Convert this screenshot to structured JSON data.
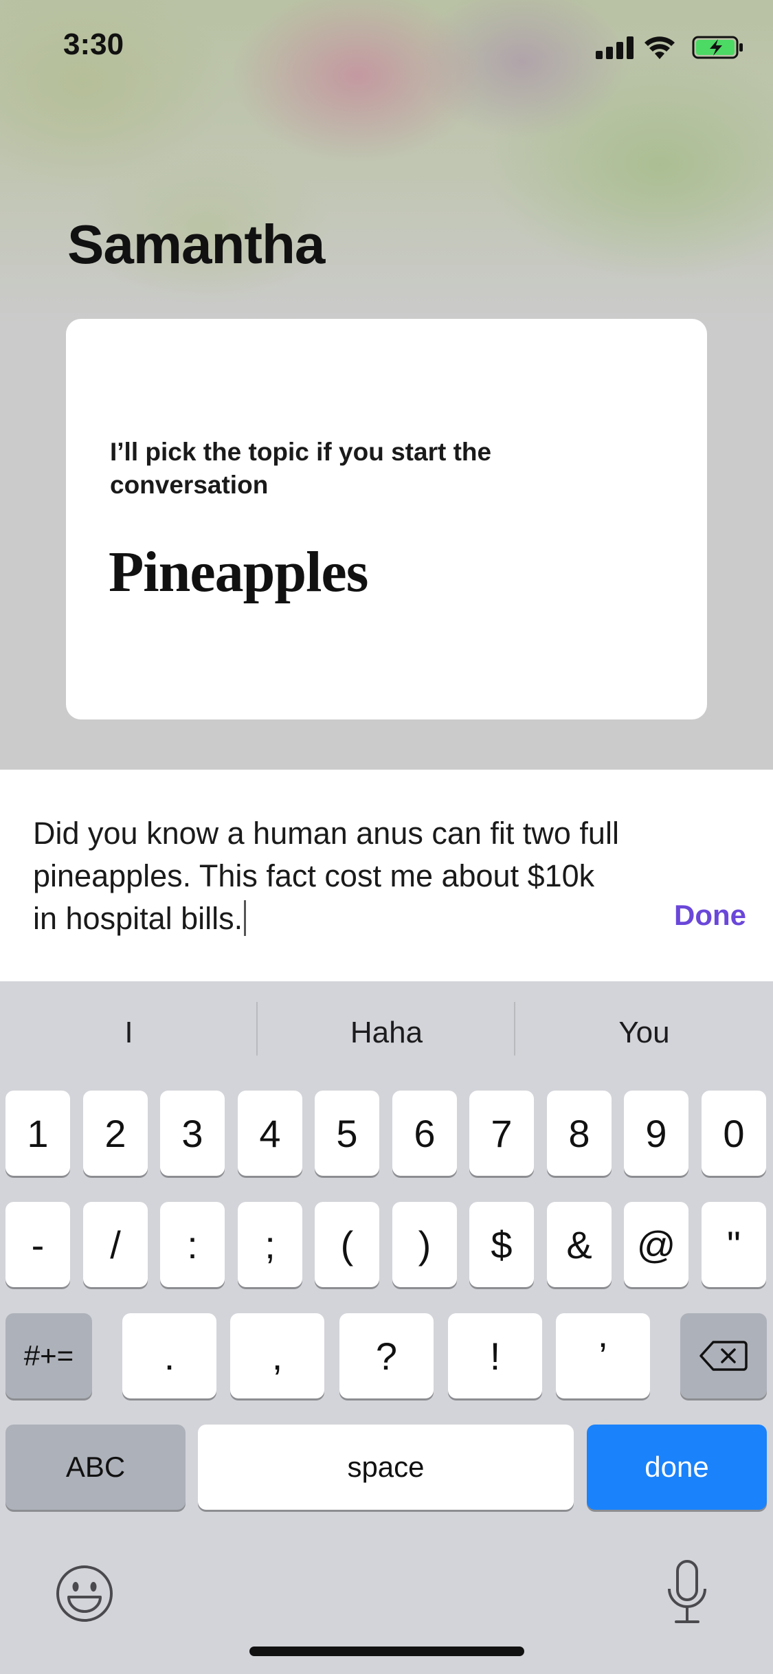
{
  "status_bar": {
    "time": "3:30"
  },
  "header": {
    "title": "Samantha"
  },
  "card": {
    "prompt": "I’ll pick the topic if you start the conversation",
    "topic": "Pineapples"
  },
  "composer": {
    "text": "Did you know a human anus can fit two full pineapples. This fact cost me about $10k in hospital bills.",
    "done_label": "Done"
  },
  "keyboard": {
    "suggestions": [
      "I",
      "Haha",
      "You"
    ],
    "row1": [
      "1",
      "2",
      "3",
      "4",
      "5",
      "6",
      "7",
      "8",
      "9",
      "0"
    ],
    "row2": [
      "-",
      "/",
      ":",
      ";",
      "(",
      ")",
      "$",
      "&",
      "@",
      "\""
    ],
    "row3_toggle": "#+=",
    "row3": [
      ".",
      ",",
      "?",
      "!",
      "’"
    ],
    "abc_label": "ABC",
    "space_label": "space",
    "return_label": "done",
    "icons": {
      "backspace": "delete-left-icon",
      "emoji": "smiley-face-icon",
      "dictation": "microphone-icon"
    },
    "accent_color": "#1a82fb"
  },
  "colors": {
    "done_link": "#6a47d9"
  }
}
